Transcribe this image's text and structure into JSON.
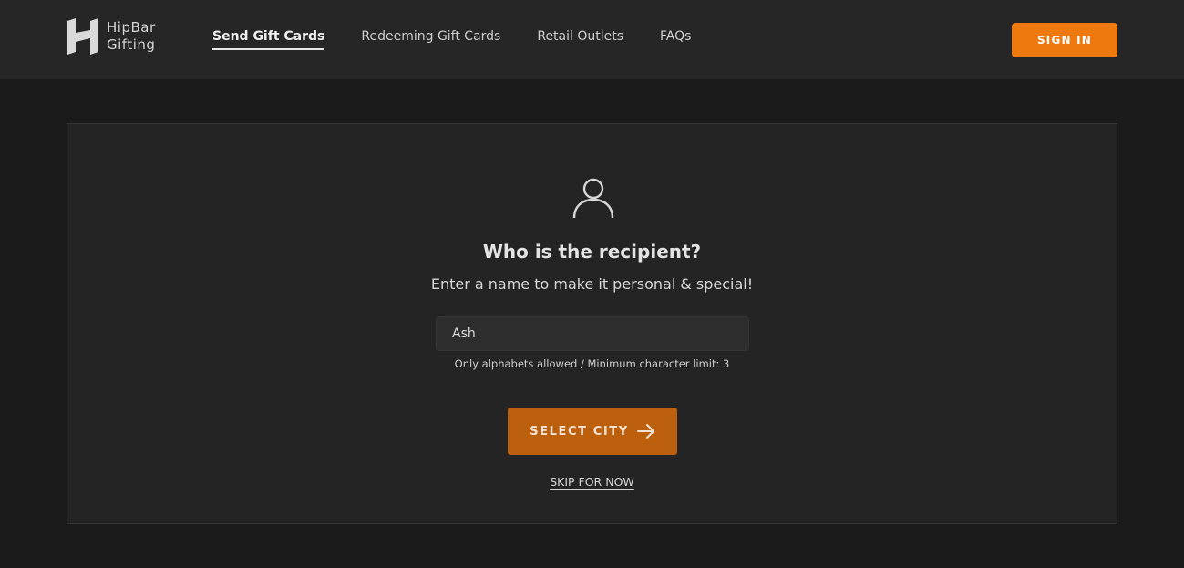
{
  "header": {
    "logo_line1": "HipBar",
    "logo_line2": "Gifting",
    "logo_icon": "hipbar-h-logo-icon",
    "nav": [
      {
        "label": "Send Gift Cards",
        "active": true
      },
      {
        "label": "Redeeming Gift Cards",
        "active": false
      },
      {
        "label": "Retail Outlets",
        "active": false
      },
      {
        "label": "FAQs",
        "active": false
      }
    ],
    "signin_label": "SIGN IN"
  },
  "main": {
    "icon": "user-icon",
    "title": "Who is the recipient?",
    "subtitle": "Enter a name to make it personal & special!",
    "name_input": {
      "value": "Ash",
      "placeholder": ""
    },
    "hint": "Only alphabets allowed / Minimum character limit: 3",
    "select_city_label": "SELECT CITY",
    "select_city_icon": "arrow-right-icon",
    "skip_label": "SKIP FOR NOW"
  },
  "colors": {
    "background": "#1b1b1b",
    "header_bg": "#262626",
    "card_bg": "#242424",
    "accent": "#ee7a0f",
    "accent_dim": "#bd600e"
  }
}
